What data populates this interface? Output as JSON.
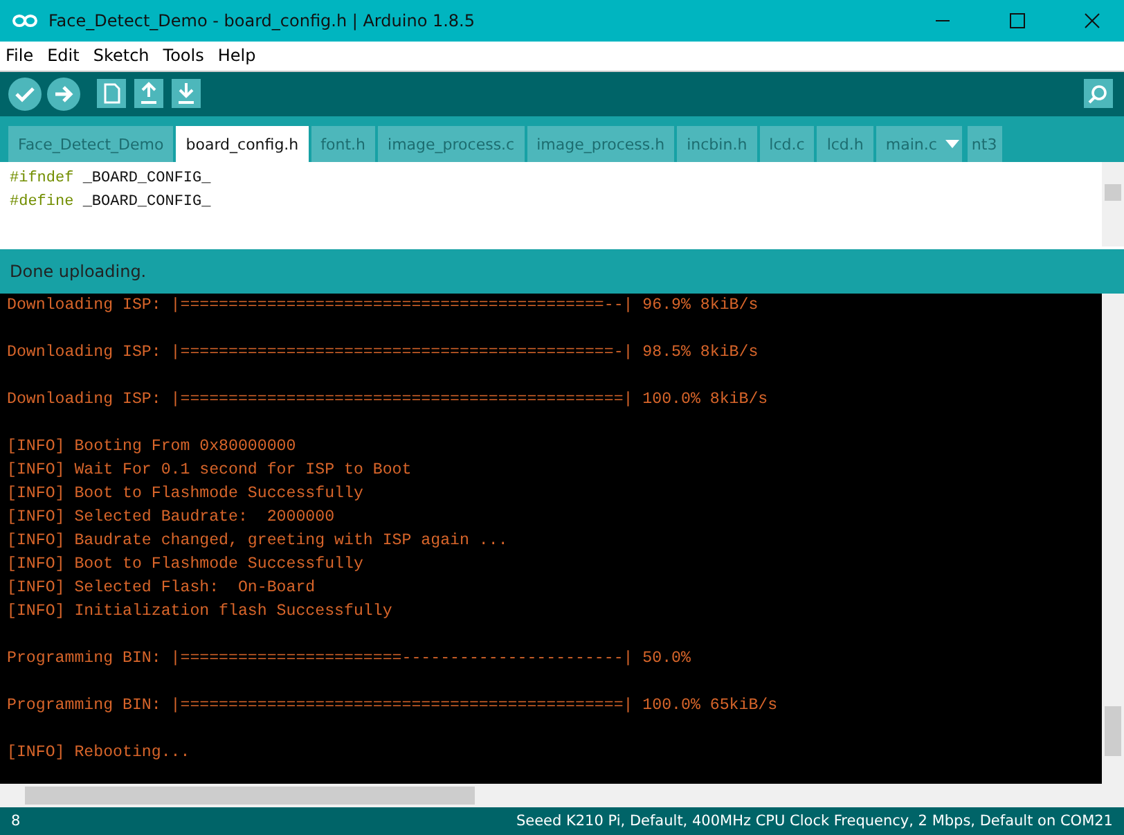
{
  "window": {
    "title": "Face_Detect_Demo - board_config.h | Arduino 1.8.5"
  },
  "menu": [
    "File",
    "Edit",
    "Sketch",
    "Tools",
    "Help"
  ],
  "tabs": [
    {
      "label": "Face_Detect_Demo",
      "selected": false
    },
    {
      "label": "board_config.h",
      "selected": true
    },
    {
      "label": "font.h",
      "selected": false
    },
    {
      "label": "image_process.c",
      "selected": false
    },
    {
      "label": "image_process.h",
      "selected": false
    },
    {
      "label": "incbin.h",
      "selected": false
    },
    {
      "label": "lcd.c",
      "selected": false
    },
    {
      "label": "lcd.h",
      "selected": false
    },
    {
      "label": "main.c",
      "selected": false
    },
    {
      "label": "nt3",
      "selected": false
    }
  ],
  "editor": {
    "lines": [
      {
        "keyword": "#ifndef",
        "rest": " _BOARD_CONFIG_"
      },
      {
        "keyword": "#define",
        "rest": " _BOARD_CONFIG_"
      }
    ]
  },
  "message": "Done uploading.",
  "console": [
    [
      "Downloading ISP: |============================================--| 96.9% 8kiB/s"
    ],
    [
      "Downloading ISP: |=============================================-| 98.5% 8kiB/s"
    ],
    [
      "Downloading ISP: |==============================================| 100.0% 8kiB/s"
    ],
    [
      "[INFO] Booting From 0x80000000",
      "[INFO] Wait For 0.1 second for ISP to Boot",
      "[INFO] Boot to Flashmode Successfully",
      "[INFO] Selected Baudrate:  2000000",
      "[INFO] Baudrate changed, greeting with ISP again ...",
      "[INFO] Boot to Flashmode Successfully",
      "[INFO] Selected Flash:  On-Board",
      "[INFO] Initialization flash Successfully"
    ],
    [
      "Programming BIN: |=======================-----------------------| 50.0%"
    ],
    [
      "Programming BIN: |==============================================| 100.0% 65kiB/s"
    ],
    [
      "[INFO] Rebooting..."
    ]
  ],
  "status_bar": {
    "line": "8",
    "board": "Seeed K210 Pi, Default, 400MHz CPU Clock Frequency, 2 Mbps, Default on COM21"
  }
}
